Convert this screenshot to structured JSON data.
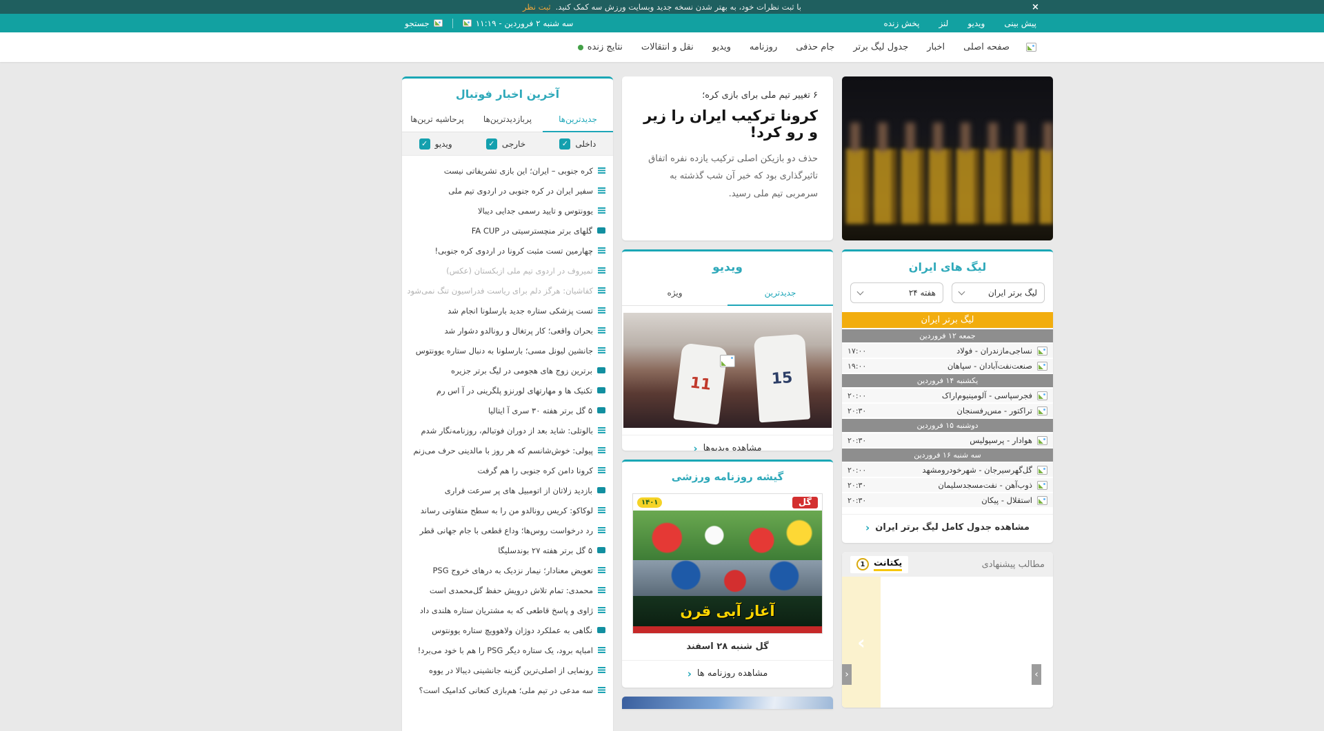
{
  "banner": {
    "message": "با ثبت نظرات خود، به بهتر شدن نسخه جدید وبسایت ورزش سه کمک کنید.",
    "link": "ثبت نظر"
  },
  "topbar": {
    "menu": [
      "پیش بینی",
      "ویدیو",
      "لنز",
      "پخش زنده"
    ],
    "date": "سه شنبه ۲ فروردین - ۱۱:۱۹",
    "search": "جستجو"
  },
  "nav": {
    "items": [
      {
        "label": "صفحه اصلی"
      },
      {
        "label": "اخبار"
      },
      {
        "label": "جدول لیگ برتر"
      },
      {
        "label": "جام حذفی"
      },
      {
        "label": "روزنامه"
      },
      {
        "label": "ویدیو"
      },
      {
        "label": "نقل و انتقالات"
      },
      {
        "label": "نتایج زنده",
        "live": true
      }
    ]
  },
  "news": {
    "title": "آخرین اخبار فوتبال",
    "tabs": [
      {
        "label": "جدیدترین‌ها",
        "active": true
      },
      {
        "label": "پربازدیدترین‌ها",
        "active": false
      },
      {
        "label": "پرحاشیه ترین‌ها",
        "active": false
      }
    ],
    "filters": [
      {
        "label": "داخلی",
        "checked": true
      },
      {
        "label": "خارجی",
        "checked": true
      },
      {
        "label": "ویدیو",
        "checked": true
      }
    ],
    "items": [
      {
        "text": "کره جنوبی – ایران؛ این بازی تشریفاتی نیست",
        "type": "text",
        "visited": false
      },
      {
        "text": "سفیر ایران در کره جنوبی در اردوی تیم ملی",
        "type": "text",
        "visited": false
      },
      {
        "text": "یوونتوس و تایید رسمی جدایی دیبالا",
        "type": "text",
        "visited": false
      },
      {
        "text": "گلهای برتر منچسترسیتی در FA CUP",
        "type": "video",
        "visited": false
      },
      {
        "text": "چهارمین تست مثبت کرونا در اردوی کره جنوبی!",
        "type": "text",
        "visited": false
      },
      {
        "text": "تمیروف در اردوی تیم ملی ازبکستان (عکس)",
        "type": "text",
        "visited": true
      },
      {
        "text": "کفاشیان: هرگز دلم برای ریاست فدراسیون تنگ نمی‌شود",
        "type": "text",
        "visited": true
      },
      {
        "text": "تست پزشکی ستاره جدید بارسلونا انجام شد",
        "type": "text",
        "visited": false
      },
      {
        "text": "بحران واقعی؛ کار پرتغال و رونالدو دشوار شد",
        "type": "text",
        "visited": false
      },
      {
        "text": "جانشین لیونل مسی؛ بارسلونا به دنبال ستاره یوونتوس",
        "type": "text",
        "visited": false
      },
      {
        "text": "برترین زوج های هجومی در لیگ برتر جزیره",
        "type": "video",
        "visited": false
      },
      {
        "text": "تکنیک ها و مهارتهای لورنزو پلگرینی در آ اس رم",
        "type": "video",
        "visited": false
      },
      {
        "text": "۵ گل برتر هفته ۳۰ سری آ ایتالیا",
        "type": "video",
        "visited": false
      },
      {
        "text": "بالوتلی: شاید بعد از دوران فوتبالم، روزنامه‌نگار شدم",
        "type": "text",
        "visited": false
      },
      {
        "text": "پیولی: خوش‌شانسم که هر روز با مالدینی حرف می‌زنم",
        "type": "text",
        "visited": false
      },
      {
        "text": "کرونا دامن کره جنوبی را هم گرفت",
        "type": "text",
        "visited": false
      },
      {
        "text": "بازدید زلاتان از اتومبیل های پر سرعت فراری",
        "type": "video",
        "visited": false
      },
      {
        "text": "لوکاکو: کریس رونالدو من را به سطح متفاوتی رساند",
        "type": "text",
        "visited": false
      },
      {
        "text": "رد درخواست روس‌ها؛ وداع قطعی با جام جهانی قطر",
        "type": "text",
        "visited": false
      },
      {
        "text": "۵ گل برتر هفته ۲۷ بوندسلیگا",
        "type": "video",
        "visited": false
      },
      {
        "text": "تعویض معنادار؛ نیمار نزدیک به درهای خروج PSG",
        "type": "text",
        "visited": false
      },
      {
        "text": "محمدی: تمام تلاش درویش حفظ گل‌محمدی است",
        "type": "text",
        "visited": false
      },
      {
        "text": "ژاوی و پاسخ قاطعی که به مشتریان ستاره هلندی داد",
        "type": "text",
        "visited": false
      },
      {
        "text": "نگاهی به عملکرد دوژان ولاهوویچ ستاره یوونتوس",
        "type": "video",
        "visited": false
      },
      {
        "text": "امباپه برود، یک ستاره دیگر PSG را هم با خود می‌برد!",
        "type": "text",
        "visited": false
      },
      {
        "text": "رونمایی از اصلی‌ترین گزینه جانشینی دیبالا در یووه",
        "type": "text",
        "visited": false
      },
      {
        "text": "سه مدعی در تیم ملی؛ هم‌بازی کنعانی کدامیک است؟",
        "type": "text",
        "visited": false
      }
    ]
  },
  "hero": {
    "kicker": "۶ تغییر تیم ملی برای بازی کره؛",
    "title": "کرونا ترکیب ایران را زیر و رو کرد!",
    "body": "حذف دو بازیکن اصلی ترکیب یازده نفره اتفاق تاثیرگذاری بود که خبر آن شب گذشته به سرمربی تیم ملی رسید."
  },
  "video": {
    "title": "ویدیو",
    "tabs": [
      {
        "label": "جدیدترین",
        "active": true
      },
      {
        "label": "ویژه",
        "active": false
      }
    ],
    "jerseys": [
      "11",
      "15"
    ],
    "more": "مشاهده ویدیوها"
  },
  "kiosk": {
    "title": "گیشه روزنامه ورزشی",
    "year": "۱۴۰۱",
    "masthead": "گل",
    "headline": "آغاز آبی قرن",
    "caption": "گل شنبه ۲۸ اسفند",
    "more": "مشاهده روزنامه ها"
  },
  "leagues": {
    "title": "لیگ های ایران",
    "league_select": "لیگ برتر ایران",
    "week_select": "هفته ۲۴",
    "table_header": "لیگ برتر ایران",
    "groups": [
      {
        "date": "جمعه ۱۲ فروردین",
        "matches": [
          {
            "home": "نساجی‌مازندران",
            "away": "فولاد",
            "time": "۱۷:۰۰"
          },
          {
            "home": "صنعت‌نفت‌آبادان",
            "away": "سپاهان",
            "time": "۱۹:۰۰"
          }
        ]
      },
      {
        "date": "یکشنبه ۱۴ فروردین",
        "matches": [
          {
            "home": "فجرسپاسی",
            "away": "آلومینیوم‌اراک",
            "time": "۲۰:۰۰"
          },
          {
            "home": "تراکتور",
            "away": "مس‌رفسنجان",
            "time": "۲۰:۳۰"
          }
        ]
      },
      {
        "date": "دوشنبه ۱۵ فروردین",
        "matches": [
          {
            "home": "هوادار",
            "away": "پرسپولیس",
            "time": "۲۰:۳۰"
          }
        ]
      },
      {
        "date": "سه شنبه ۱۶ فروردین",
        "matches": [
          {
            "home": "گل‌گهرسیرجان",
            "away": "شهرخودرومشهد",
            "time": "۲۰:۰۰"
          },
          {
            "home": "ذوب‌آهن",
            "away": "نفت‌مسجدسلیمان",
            "time": "۲۰:۳۰"
          },
          {
            "home": "استقلال",
            "away": "پیکان",
            "time": "۲۰:۳۰"
          }
        ]
      }
    ],
    "more": "مشاهده جدول کامل لیگ برتر ایران"
  },
  "suggested": {
    "title": "مطالب پیشنهادی",
    "brand": "یکتانت",
    "badge": "1"
  },
  "icons": {
    "close": "×",
    "check": "✓",
    "chevron": "‹",
    "carousel_prev": "‹",
    "carousel_next": "›",
    "ad_arrow": "›"
  },
  "colors": {
    "accent_teal": "#1da6b8",
    "brand_teal": "#12a1a1",
    "banner_orange": "#f3a83a",
    "league_amber": "#f2ad0e",
    "live_green": "#43a047"
  }
}
